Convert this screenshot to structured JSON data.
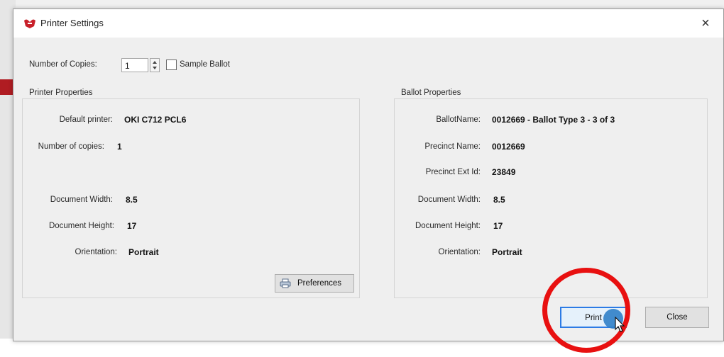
{
  "dialog": {
    "title": "Printer Settings",
    "close_glyph": "×",
    "icon": "ballot-app-icon"
  },
  "copies": {
    "label": "Number  of Copies:",
    "value": "1",
    "sample_ballot_label": "Sample Ballot",
    "sample_ballot_checked": false
  },
  "printer_properties": {
    "title": "Printer Properties",
    "rows": [
      {
        "label": "Default printer:",
        "value": "OKI C712 PCL6"
      },
      {
        "label": "Number of copies:",
        "value": "1"
      },
      {
        "label": "Document Width:",
        "value": "8.5"
      },
      {
        "label": "Document Height:",
        "value": "17"
      },
      {
        "label": "Orientation:",
        "value": "Portrait"
      }
    ],
    "preferences_label": "Preferences"
  },
  "ballot_properties": {
    "title": "Ballot Properties",
    "rows": [
      {
        "label": "BallotName:",
        "value": "0012669 - Ballot Type 3 - 3 of 3"
      },
      {
        "label": "Precinct Name:",
        "value": "0012669"
      },
      {
        "label": "Precinct Ext Id:",
        "value": "23849"
      },
      {
        "label": "Document Width:",
        "value": "8.5"
      },
      {
        "label": "Document Height:",
        "value": "17"
      },
      {
        "label": "Orientation:",
        "value": "Portrait"
      }
    ]
  },
  "footer": {
    "print_label": "Print",
    "close_label": "Close"
  },
  "colors": {
    "highlight_circle": "#e81010",
    "default_button_border": "#2c7be5"
  }
}
